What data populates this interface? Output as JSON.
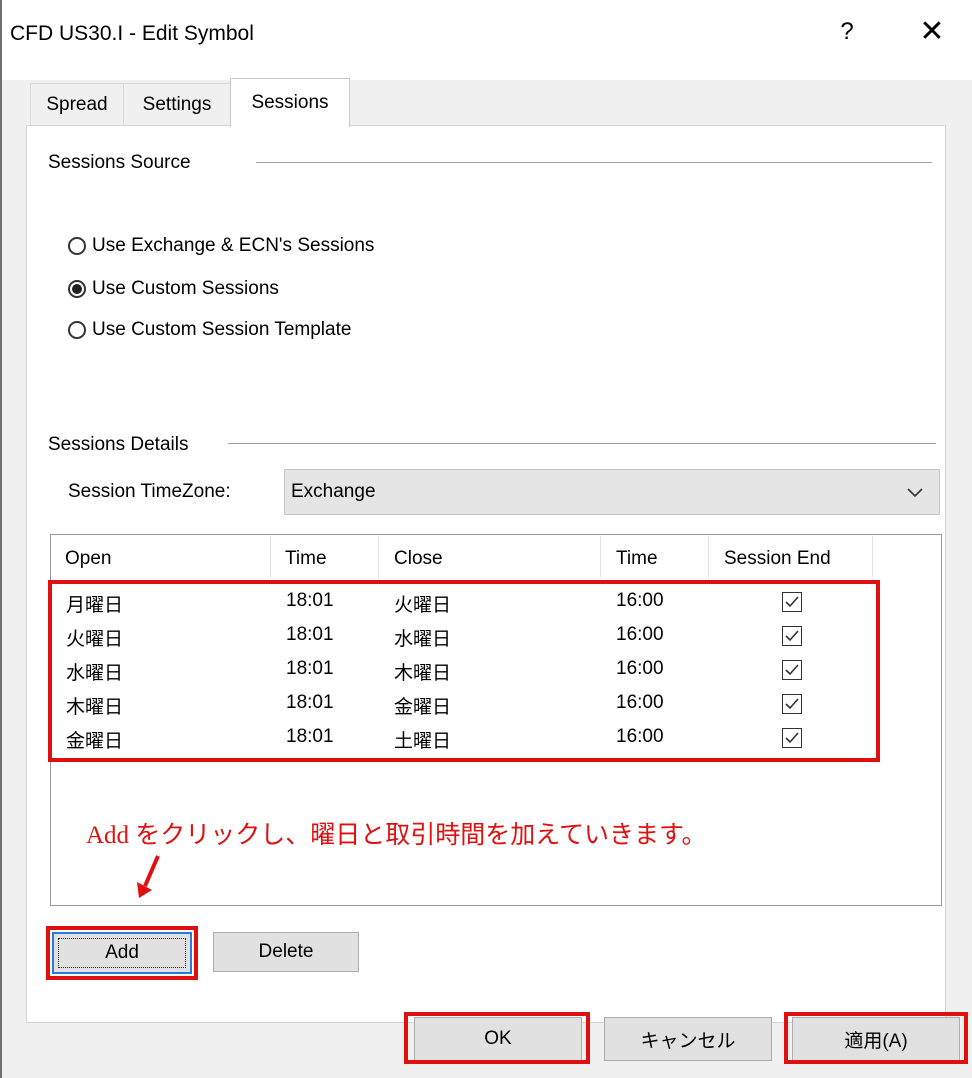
{
  "window": {
    "title": "CFD US30.I - Edit Symbol",
    "help_glyph": "?",
    "close_glyph": "✕"
  },
  "tabs": [
    {
      "label": "Spread",
      "active": false
    },
    {
      "label": "Settings",
      "active": false
    },
    {
      "label": "Sessions",
      "active": true
    }
  ],
  "source": {
    "label": "Sessions Source",
    "options": [
      {
        "label": "Use Exchange & ECN's Sessions",
        "checked": false
      },
      {
        "label": "Use Custom Sessions",
        "checked": true
      },
      {
        "label": "Use Custom Session Template",
        "checked": false
      }
    ]
  },
  "details": {
    "label": "Sessions Details",
    "timezone_label": "Session TimeZone:",
    "timezone_value": "Exchange"
  },
  "table": {
    "columns": [
      "Open",
      "Time",
      "Close",
      "Time",
      "Session End"
    ],
    "rows": [
      {
        "open": "月曜日",
        "open_time": "18:01",
        "close": "火曜日",
        "close_time": "16:00",
        "session_end": true
      },
      {
        "open": "火曜日",
        "open_time": "18:01",
        "close": "水曜日",
        "close_time": "16:00",
        "session_end": true
      },
      {
        "open": "水曜日",
        "open_time": "18:01",
        "close": "木曜日",
        "close_time": "16:00",
        "session_end": true
      },
      {
        "open": "木曜日",
        "open_time": "18:01",
        "close": "金曜日",
        "close_time": "16:00",
        "session_end": true
      },
      {
        "open": "金曜日",
        "open_time": "18:01",
        "close": "土曜日",
        "close_time": "16:00",
        "session_end": true
      }
    ]
  },
  "annotation": {
    "text": "Add をクリックし、曜日と取引時間を加えていきます。"
  },
  "buttons": {
    "add": "Add",
    "delete": "Delete",
    "ok": "OK",
    "cancel": "キャンセル",
    "apply": "適用(A)"
  },
  "colors": {
    "highlight_red": "#e01010",
    "button_face": "#e1e1e1",
    "default_border": "#2a7bd8"
  }
}
